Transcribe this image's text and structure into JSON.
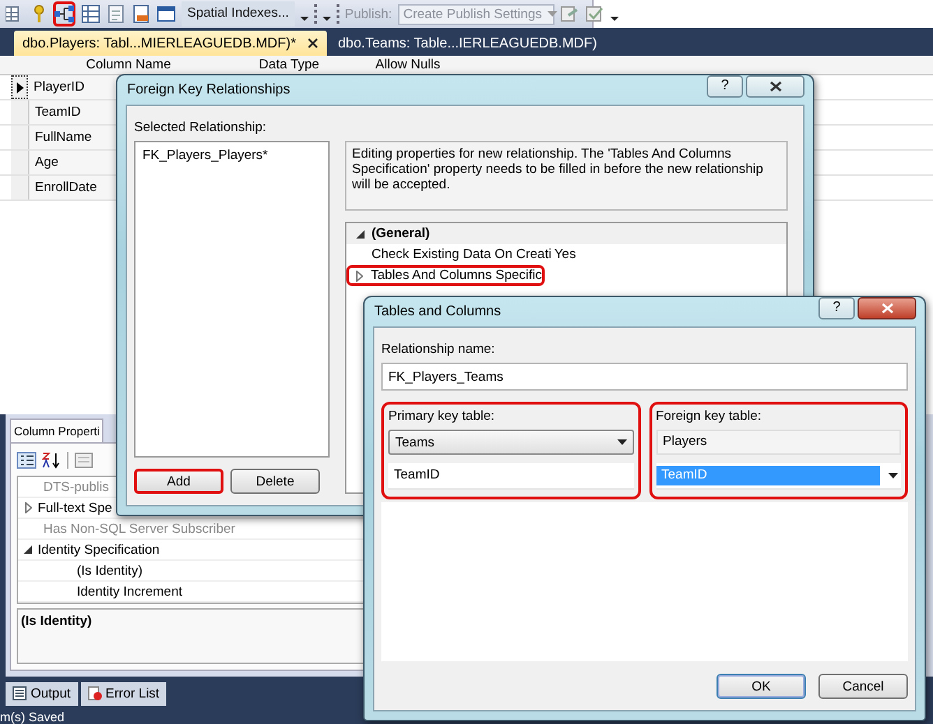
{
  "toolbar": {
    "relationships_highlighted": true,
    "spatial_indexes": "Spatial Indexes...",
    "publish_label": "Publish:",
    "publish_settings": {
      "value": "Create Publish Settings",
      "disabled": true
    }
  },
  "tabs": [
    {
      "label": "dbo.Players: Tabl...MIERLEAGUEDB.MDF)*",
      "selected": true
    },
    {
      "label": "dbo.Teams: Table...IERLEAGUEDB.MDF)",
      "selected": false
    }
  ],
  "table": {
    "columns": [
      "Column Name",
      "Data Type",
      "Allow Nulls"
    ],
    "rows": [
      {
        "name": "PlayerID",
        "current": true
      },
      {
        "name": "TeamID",
        "current": false
      },
      {
        "name": "FullName",
        "current": false
      },
      {
        "name": "Age",
        "current": false
      },
      {
        "name": "EnrollDate",
        "current": false
      }
    ]
  },
  "column_properties": {
    "title": "Column Properti",
    "rows": [
      {
        "kind": "disabled",
        "label": "DTS-publis"
      },
      {
        "kind": "group",
        "label": "Full-text Spe",
        "expanded": false
      },
      {
        "kind": "disabled",
        "label": "Has Non-SQL Server Subscriber"
      },
      {
        "kind": "group",
        "label": "Identity Specification",
        "expanded": true
      },
      {
        "kind": "child",
        "label": "(Is Identity)"
      },
      {
        "kind": "child",
        "label": "Identity Increment"
      }
    ],
    "description_title": "(Is Identity)"
  },
  "output_tabs": [
    "Output",
    "Error List"
  ],
  "status_bar": "m(s) Saved",
  "fk_dialog": {
    "title": "Foreign Key Relationships",
    "help_button": "?",
    "selected_relationship_label": "Selected Relationship:",
    "relationships": [
      "FK_Players_Players*"
    ],
    "description": "Editing properties for new relationship.  The 'Tables And Columns Specification' property needs to be filled in before the new relationship will be accepted.",
    "properties": [
      {
        "kind": "category",
        "label": "(General)",
        "expanded": true,
        "highlighted": false
      },
      {
        "kind": "property",
        "label": "Check Existing Data On Creati",
        "value": "Yes",
        "highlighted": false
      },
      {
        "kind": "group",
        "label": "Tables And Columns Specific",
        "expanded": false,
        "highlighted": true
      }
    ],
    "buttons": [
      {
        "label": "Add",
        "highlighted": true
      },
      {
        "label": "Delete",
        "highlighted": false
      }
    ]
  },
  "tc_dialog": {
    "title": "Tables and Columns",
    "help_button": "?",
    "relationship_name_label": "Relationship name:",
    "relationship_name": "FK_Players_Teams",
    "groups": [
      {
        "label": "Primary key table:",
        "table": {
          "kind": "combo",
          "value": "Teams"
        },
        "column": {
          "value": "TeamID",
          "selected": false
        },
        "highlighted": true
      },
      {
        "label": "Foreign key table:",
        "table": {
          "kind": "readonly",
          "value": "Players"
        },
        "column": {
          "value": "TeamID",
          "selected": true
        },
        "highlighted": true
      }
    ],
    "buttons": [
      {
        "label": "OK",
        "default": true
      },
      {
        "label": "Cancel",
        "default": false
      }
    ]
  }
}
